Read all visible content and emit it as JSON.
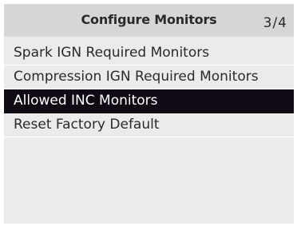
{
  "header": {
    "title": "Configure Monitors",
    "page_indicator": "3/4"
  },
  "menu": {
    "items": [
      {
        "label": "Spark IGN Required Monitors",
        "selected": false
      },
      {
        "label": "Compression IGN Required Monitors",
        "selected": false
      },
      {
        "label": "Allowed INC Monitors",
        "selected": true
      },
      {
        "label": "Reset Factory Default",
        "selected": false
      }
    ]
  },
  "colors": {
    "header_bg": "#d6d6d6",
    "screen_bg": "#ebebeb",
    "selected_bg": "#0f0a14",
    "selected_text": "#ffffff",
    "text": "#2a2a2a"
  }
}
